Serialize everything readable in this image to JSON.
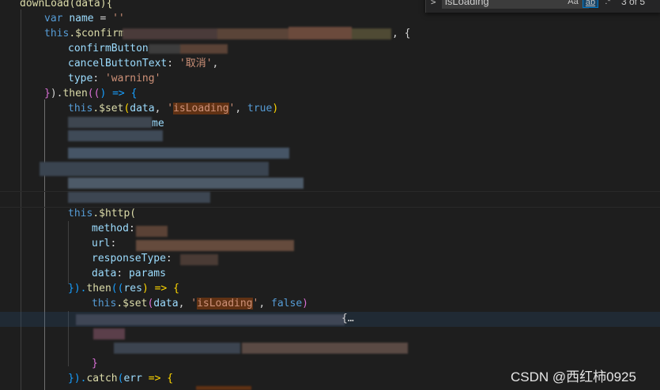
{
  "find_widget": {
    "toggle_glyph": ">",
    "query": "isLoading",
    "match_case": "Aa",
    "whole_word": "ab",
    "regex": ".*",
    "count": "3 of 5"
  },
  "code": {
    "l0": "downLoad(data){",
    "l1_kw": "var",
    "l1_name": "name",
    "l1_eq": " = ",
    "l1_str": "''",
    "l2_this": "this",
    "l2_fn": ".$confirm",
    "l2_tail": ", {",
    "l3": "confirmButton",
    "l4_prop": "cancelButtonText",
    "l4_colon": ": ",
    "l4_str": "'取消'",
    "l4_comma": ",",
    "l5_prop": "type",
    "l5_colon": ": ",
    "l5_str": "'warning'",
    "l6_a": "}",
    "l6_b": ").",
    "l6_then": "then",
    "l6_c": "((",
    "l6_d": ") => {",
    "l7_this": "this",
    "l7_fn": ".$set",
    "l7_open": "(",
    "l7_arg": "data",
    "l7_sep": ", ",
    "l7_q1": "'",
    "l7_mark": "isLoading",
    "l7_q2": "'",
    "l7_sep2": ", ",
    "l7_true": "true",
    "l7_close": ")",
    "l8_tail": "me",
    "l13_this": "this",
    "l13_fn": ".$http(",
    "l14_prop": "method",
    "l14_colon": ":",
    "l15_prop": "url",
    "l15_colon": ":",
    "l16_prop": "responseType",
    "l16_colon": ":",
    "l17_prop": "data",
    "l17_colon": ": ",
    "l17_val": "params",
    "l18_a": "}).",
    "l18_then": "then",
    "l18_b": "((",
    "l18_res": "res",
    "l18_c": ") => {",
    "l19_this": "this",
    "l19_fn": ".$set",
    "l19_open": "(",
    "l19_arg": "data",
    "l19_sep": ", ",
    "l19_q1": "'",
    "l19_mark": "isLoading",
    "l19_q2": "'",
    "l19_sep2": ", ",
    "l19_false": "false",
    "l19_close": ")",
    "l20_tail": "{…",
    "l23": "}",
    "l24_a": "}).",
    "l24_catch": "catch",
    "l24_b": "(",
    "l24_err": "err",
    "l24_c": " => {"
  },
  "watermark": "CSDN @西红柿0925",
  "colors": {
    "background": "#1e1e1e",
    "keyword": "#569cd6",
    "function": "#dcdcaa",
    "string": "#ce9178",
    "property": "#9cdcfe",
    "find_highlight": "#613214"
  }
}
